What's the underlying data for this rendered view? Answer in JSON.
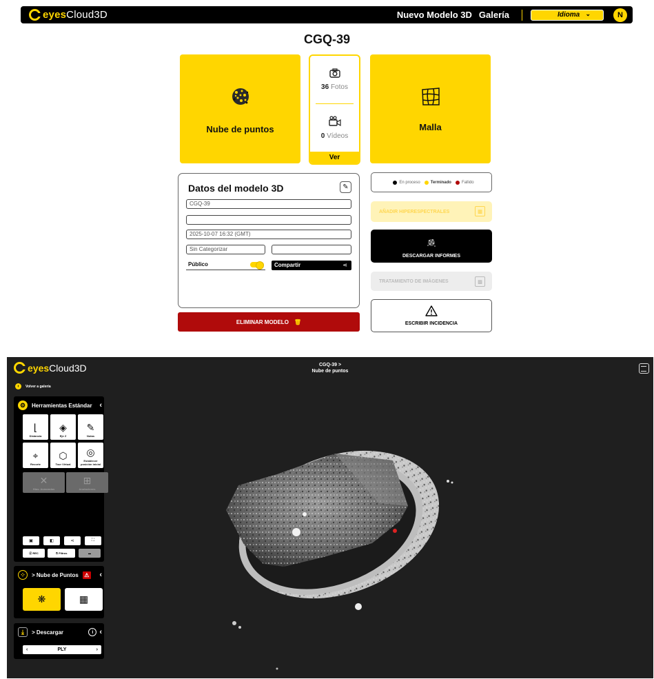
{
  "header": {
    "logo_brand": "eyes",
    "logo_rest": "Cloud3D",
    "nav_new_model": "Nuevo Modelo 3D",
    "nav_gallery": "Galería",
    "language_label": "Idioma",
    "avatar_letter": "N"
  },
  "model": {
    "title": "CGQ-39",
    "pointcloud_label": "Nube de puntos",
    "mesh_label": "Malla",
    "photos_count": "36",
    "photos_label": "Fotos",
    "videos_count": "0",
    "videos_label": "Vídeos",
    "view_label": "Ver"
  },
  "datos": {
    "title": "Datos del modelo 3D",
    "name_value": "CGQ-39",
    "description_value": "",
    "date_value": "2025-10-07 16:32 (GMT)",
    "category_value": "Sin Categorizar",
    "subcategory_value": "",
    "public_label": "Público",
    "share_label": "Compartir"
  },
  "delete_label": "ELIMINAR MODELO",
  "legend": {
    "in_process": "En proceso",
    "finished": "Terminado",
    "failed": "Fallido"
  },
  "actions": {
    "hyperspectral": "AÑADIR HIPERESPECTRALES",
    "reports": "DESCARGAR INFORMES",
    "image_processing": "TRATAMIENTO DE IMÁGENES",
    "incident": "ESCRIBIR INCIDENCIA"
  },
  "viewer": {
    "title_line1": "CGQ-39 >",
    "title_line2": "Nube de puntos",
    "back_label": "Volver a galería",
    "tools_title": "Herramientas Estándar",
    "tools": {
      "distance": "Distancia",
      "z_axis": "Eje Z",
      "notes": "Notas",
      "cut": "Recorte",
      "virtual_tour": "Tour Virtual",
      "set_initial_line1": "Establecer",
      "set_initial_line2": "posición inicial",
      "advanced": "Htas. Avanzadas",
      "annotations": "Anotaciones"
    },
    "rec_label": "REC",
    "filters_label": "Filtros",
    "pointcloud_panel_title": "> Nube de Puntos",
    "download_panel_title": "> Descargar",
    "format_value": "PLY"
  },
  "colors": {
    "accent": "#FFD600",
    "danger": "#B00B0B",
    "dark": "#000000",
    "viewer_bg": "#1F1F1F"
  }
}
